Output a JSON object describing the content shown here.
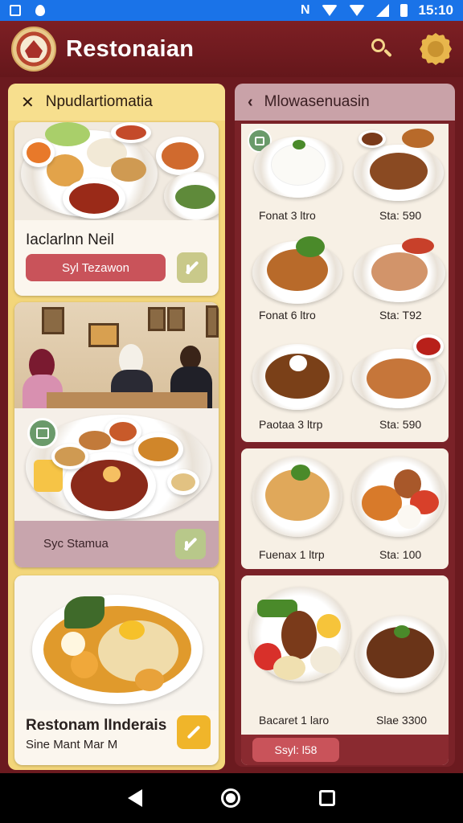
{
  "status_bar": {
    "time": "15:10",
    "carrier_glyph": "N",
    "icons": [
      "square-icon",
      "drop-icon",
      "wifi-icon",
      "signal-icon",
      "battery-icon"
    ]
  },
  "app_bar": {
    "title": "Restonaian",
    "icons": [
      "logo-emblem",
      "search-icon",
      "badge-icon"
    ]
  },
  "left_panel": {
    "header": "Npudlartiomatia",
    "cards": [
      {
        "title": "Iaclarlnn Neil",
        "button_label": "Syl Tezawon"
      },
      {
        "button_label": "Syc Stamua"
      },
      {
        "title": "Restonam lInderais",
        "subtitle": "Sine Mant Mar M"
      }
    ]
  },
  "right_panel": {
    "header": "Mlowasenuasin",
    "items": [
      {
        "left": "Fonat 3 ltro",
        "right": "Sta: 590"
      },
      {
        "left": "Fonat 6 ltro",
        "right": "Sta: T92"
      },
      {
        "left": "Paotaa 3 ltrp",
        "right": "Sta: 590"
      },
      {
        "left": "Fuenax 1 ltrp",
        "right": "Sta: 100"
      },
      {
        "left": "Bacaret 1 laro",
        "right": "Slae 3300"
      }
    ],
    "bottom_button": "Ssyl: l58"
  },
  "colors": {
    "app_bar": "#7d1f24",
    "left_panel": "#f3d67a",
    "accent_red": "#c9535a",
    "accent_orange": "#f0b52a"
  }
}
